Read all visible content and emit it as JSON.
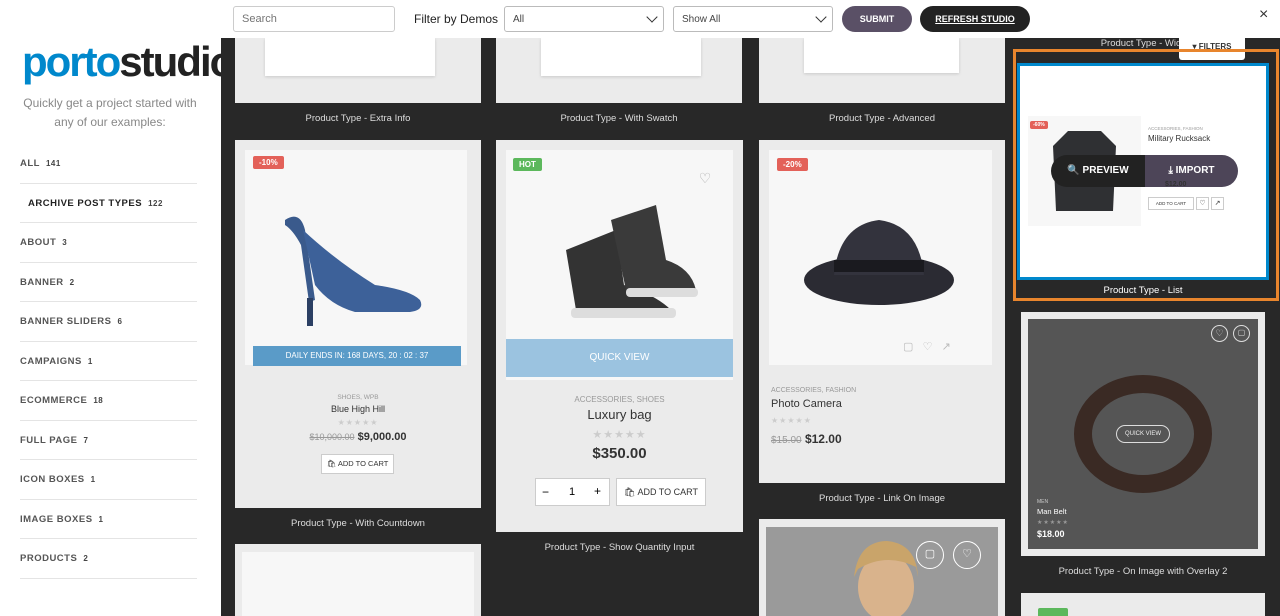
{
  "toolbar": {
    "search_placeholder": "Search",
    "filter_label": "Filter by Demos",
    "demo_select": "All",
    "show_select": "Show All",
    "submit": "SUBMIT",
    "refresh": "REFRESH STUDIO",
    "close": "×"
  },
  "sidebar": {
    "logo_a": "porto",
    "logo_b": "studio",
    "tagline": "Quickly get a project started with any of our examples:",
    "cats": [
      {
        "label": "ALL",
        "count": "141"
      },
      {
        "label": "ARCHIVE POST TYPES",
        "count": "122"
      },
      {
        "label": "ABOUT",
        "count": "3"
      },
      {
        "label": "BANNER",
        "count": "2"
      },
      {
        "label": "BANNER SLIDERS",
        "count": "6"
      },
      {
        "label": "CAMPAIGNS",
        "count": "1"
      },
      {
        "label": "ECOMMERCE",
        "count": "18"
      },
      {
        "label": "FULL PAGE",
        "count": "7"
      },
      {
        "label": "ICON BOXES",
        "count": "1"
      },
      {
        "label": "IMAGE BOXES",
        "count": "1"
      },
      {
        "label": "PRODUCTS",
        "count": "2"
      }
    ]
  },
  "grid": {
    "top_captions": [
      "Product Type - Extra Info",
      "Product Type - With Swatch",
      "Product Type - Advanced",
      "Product Type - Wid"
    ],
    "filters_btn": "FILTERS",
    "c1": {
      "badge": "-10%",
      "countdown": "DAILY ENDS IN: 168 DAYS, 20 : 02 : 37",
      "cat": "SHOES, WPB",
      "name": "Blue High Hill",
      "old": "$10,000.00",
      "price": "$9,000.00",
      "cart": "ADD TO CART",
      "caption": "Product Type - With Countdown"
    },
    "c2": {
      "badge": "HOT",
      "quick": "QUICK VIEW",
      "cat": "ACCESSORIES, SHOES",
      "name": "Luxury bag",
      "price": "$350.00",
      "qty": "1",
      "minus": "−",
      "plus": "+",
      "cart": "ADD TO CART",
      "caption": "Product Type - Show Quantity Input"
    },
    "c3": {
      "badge": "-20%",
      "cat": "ACCESSORIES, FASHION",
      "name": "Photo Camera",
      "old": "$15.00",
      "price": "$12.00",
      "caption": "Product Type - Link On Image"
    },
    "c4": {
      "badge": "-60%",
      "cat": "ACCESSORIES, FASHION",
      "name": "Military Rucksack",
      "preview": "PREVIEW",
      "import": "IMPORT",
      "cart": "ADD TO CART",
      "price": "$12.00",
      "caption": "Product Type - List"
    },
    "c5": {
      "quick": "QUICK VIEW",
      "cat": "MEN",
      "name": "Man Belt",
      "price": "$18.00",
      "caption": "Product Type - On Image with Overlay 2"
    },
    "stars": "★★★★★"
  },
  "colors": {
    "accent": "#0088cc",
    "highlight": "#e8852d",
    "hot": "#5cb85c",
    "sale": "#e36159"
  }
}
